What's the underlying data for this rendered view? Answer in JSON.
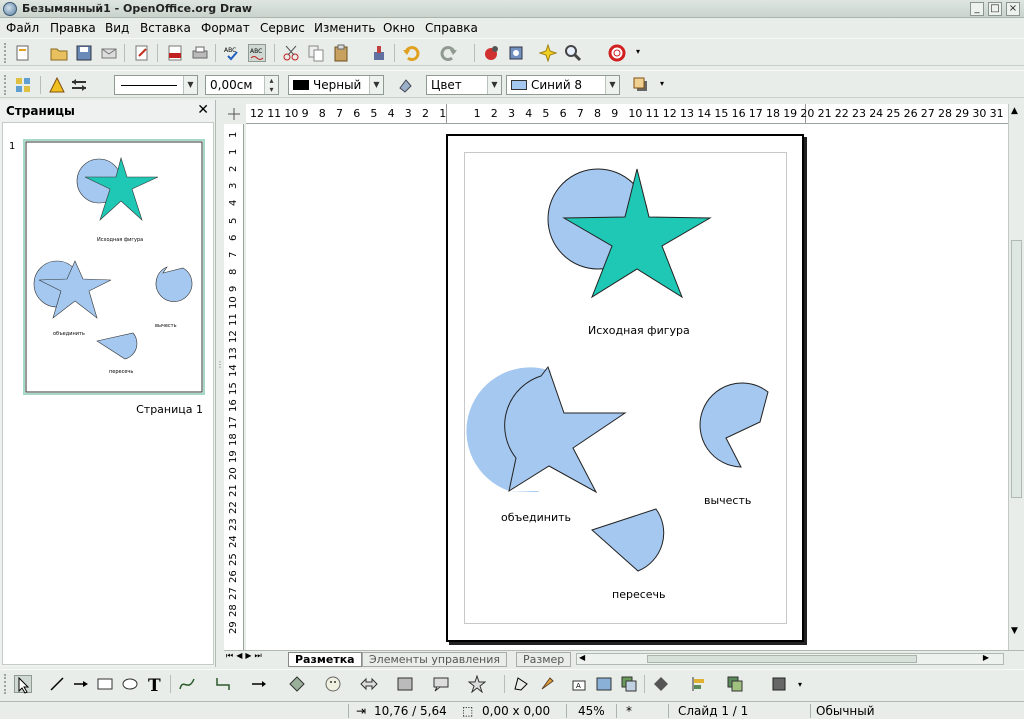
{
  "window": {
    "title": "Безымянный1 - OpenOffice.org Draw",
    "controls": [
      "minimize-icon",
      "maximize-icon",
      "close-icon"
    ]
  },
  "menu": [
    "Файл",
    "Правка",
    "Вид",
    "Вставка",
    "Формат",
    "Сервис",
    "Изменить",
    "Окно",
    "Справка"
  ],
  "toolbar_standard": {
    "icons": [
      "new-icon",
      "open-icon",
      "save-icon",
      "email-icon",
      "edit-file-icon",
      "export-pdf-icon",
      "print-icon",
      "spellcheck-icon",
      "autospellcheck-icon",
      "cut-icon",
      "copy-icon",
      "paste-icon",
      "clone-format-icon",
      "undo-icon",
      "redo-icon",
      "gallery-icon",
      "navigator-icon",
      "effects-icon",
      "zoom-icon",
      "help-icon"
    ]
  },
  "toolbar_line_fill": {
    "line_width": "0,00см",
    "line_color": "Черный",
    "line_color_swatch": "#000000",
    "area_style": "Цвет",
    "fill_color": "Синий 8",
    "fill_color_swatch": "#a4c8f0"
  },
  "colors": {
    "accent_fill": "#a4c8f0",
    "star_fill": "#1fc8b4",
    "chrome": "#e8ede9"
  },
  "pages_panel": {
    "title": "Страницы",
    "page_number": "1",
    "page_label": "Страница 1",
    "thumb_labels": [
      "Исходная фигура",
      "объединить",
      "вычесть",
      "пересечь"
    ]
  },
  "ruler_h": [
    "12",
    "11",
    "10",
    "9",
    "8",
    "7",
    "6",
    "5",
    "4",
    "3",
    "2",
    "1",
    "",
    "1",
    "2",
    "3",
    "4",
    "5",
    "6",
    "7",
    "8",
    "9",
    "10",
    "11",
    "12",
    "13",
    "14",
    "15",
    "16",
    "17",
    "18",
    "19",
    "20",
    "21",
    "22",
    "23",
    "24",
    "25",
    "26",
    "27",
    "28",
    "29",
    "30",
    "31"
  ],
  "ruler_v": [
    "1",
    "1",
    "2",
    "3",
    "4",
    "5",
    "6",
    "7",
    "8",
    "9",
    "10",
    "11",
    "12",
    "13",
    "14",
    "15",
    "16",
    "17",
    "18",
    "19",
    "20",
    "21",
    "22",
    "23",
    "24",
    "25",
    "26",
    "27",
    "28",
    "29"
  ],
  "canvas": {
    "label_source": "Исходная фигура",
    "label_union": "объединить",
    "label_subtract": "вычесть",
    "label_intersect": "пересечь"
  },
  "tabs": {
    "active": "Разметка",
    "items": [
      "Элементы управления",
      "Размер"
    ]
  },
  "drawing_toolbar": {
    "icons": [
      "select-icon",
      "line-icon",
      "arrow-line-icon",
      "rectangle-icon",
      "ellipse-icon",
      "text-icon",
      "curve-icon",
      "connector-icon",
      "lines-arrows-icon",
      "basic-shapes-icon",
      "symbol-shapes-icon",
      "block-arrows-icon",
      "flowchart-icon",
      "callouts-icon",
      "stars-icon",
      "points-icon",
      "glue-points-icon",
      "fontwork-icon",
      "from-file-icon",
      "gallery-icon",
      "rotate-icon",
      "align-icon",
      "arrange-icon",
      "extrusion-icon"
    ]
  },
  "status": {
    "position": "10,76 / 5,64",
    "size": "0,00 x 0,00",
    "zoom": "45%",
    "modified": "*",
    "slide": "Слайд 1 / 1",
    "style": "Обычный"
  }
}
